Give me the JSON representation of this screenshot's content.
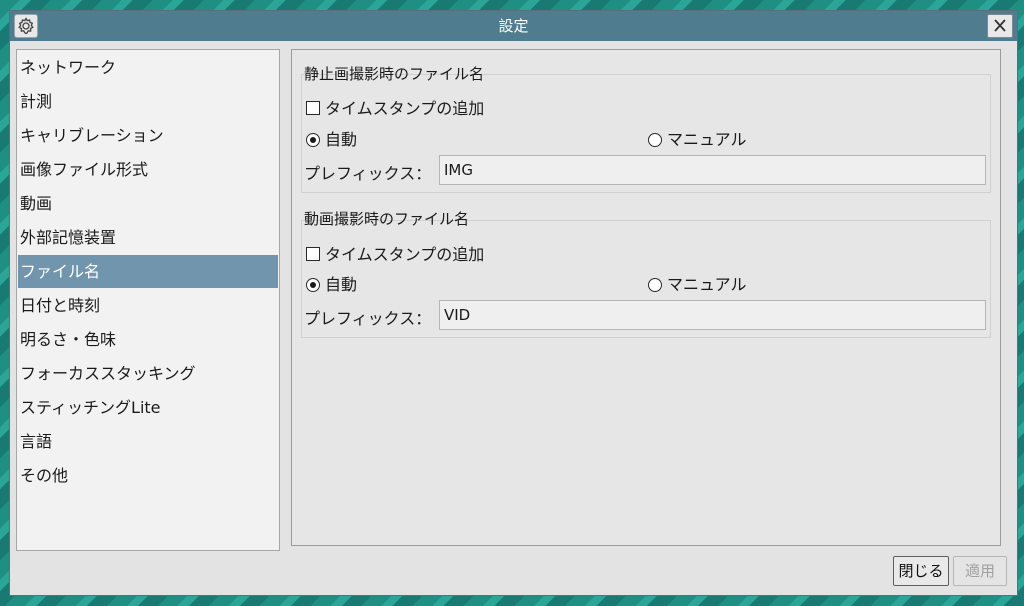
{
  "window": {
    "title": "設定",
    "app_icon": "gear-icon",
    "close_icon": "close-icon"
  },
  "sidebar": {
    "items": [
      {
        "label": "ネットワーク"
      },
      {
        "label": "計測"
      },
      {
        "label": "キャリブレーション"
      },
      {
        "label": "画像ファイル形式"
      },
      {
        "label": "動画"
      },
      {
        "label": "外部記憶装置"
      },
      {
        "label": "ファイル名",
        "selected": true
      },
      {
        "label": "日付と時刻"
      },
      {
        "label": "明るさ・色味"
      },
      {
        "label": "フォーカススタッキング"
      },
      {
        "label": "スティッチングLite"
      },
      {
        "label": "言語"
      },
      {
        "label": "その他"
      }
    ]
  },
  "still": {
    "title": "静止画撮影時のファイル名",
    "timestamp_label": "タイムスタンプの追加",
    "timestamp_checked": false,
    "auto_label": "自動",
    "manual_label": "マニュアル",
    "selected_mode": "auto",
    "prefix_label": "プレフィックス：",
    "prefix_value": "IMG"
  },
  "video": {
    "title": "動画撮影時のファイル名",
    "timestamp_label": "タイムスタンプの追加",
    "timestamp_checked": false,
    "auto_label": "自動",
    "manual_label": "マニュアル",
    "selected_mode": "auto",
    "prefix_label": "プレフィックス：",
    "prefix_value": "VID"
  },
  "footer": {
    "close_label": "閉じる",
    "apply_label": "適用",
    "apply_enabled": false
  },
  "colors": {
    "titlebar": "#4f7d8f",
    "selection": "#7295ae"
  }
}
